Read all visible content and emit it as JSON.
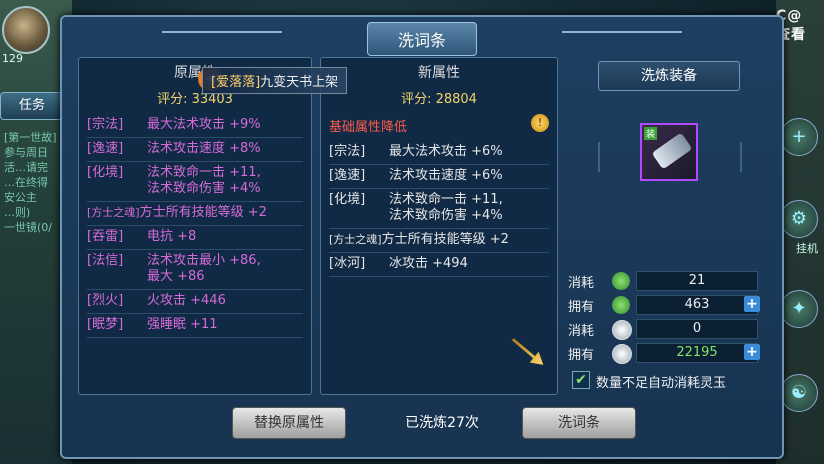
{
  "hud": {
    "level": "129",
    "task_tab": "任务",
    "task_lines": [
      "[第一世故]",
      "参与周日",
      "活…请完",
      "…在终得",
      "安公主",
      "…则)",
      "一世镜(0/"
    ],
    "top_logo": "C@ 查看",
    "side_labels": [
      "挂机"
    ]
  },
  "dialog": {
    "title": "洗词条",
    "notice": {
      "name": "[爱落落]",
      "text": "九变天书上架"
    },
    "left_panel": {
      "header": "原属性",
      "score_label": "评分: ",
      "score": "33403",
      "attributes": [
        {
          "tag": "[宗法]",
          "value": "最大法术攻击 +9%"
        },
        {
          "tag": "[逸速]",
          "value": "法术攻击速度 +8%"
        },
        {
          "tag": "[化境]",
          "value": "法术致命一击 +11,\n法术致命伤害 +4%"
        },
        {
          "tag": "[方士之魂]",
          "value": "方士所有技能等级 +2"
        },
        {
          "tag": "[吞雷]",
          "value": "电抗 +8"
        },
        {
          "tag": "[法信]",
          "value": "法术攻击最小 +86,\n最大 +86"
        },
        {
          "tag": "[烈火]",
          "value": "火攻击 +446"
        },
        {
          "tag": "[眠梦]",
          "value": "强睡眠 +11"
        }
      ]
    },
    "mid_panel": {
      "header": "新属性",
      "score_label": "评分: ",
      "score": "28804",
      "warning": "基础属性降低",
      "attributes": [
        {
          "tag": "[宗法]",
          "value": "最大法术攻击 +6%"
        },
        {
          "tag": "[逸速]",
          "value": "法术攻击速度 +6%"
        },
        {
          "tag": "[化境]",
          "value": "法术致命一击 +11,\n法术致命伤害 +4%"
        },
        {
          "tag": "[方士之魂]",
          "value": "方士所有技能等级 +2"
        },
        {
          "tag": "[冰河]",
          "value": "冰攻击 +494"
        }
      ]
    },
    "right_panel": {
      "header": "洗炼装备",
      "equip_badge": "装",
      "costs": [
        {
          "label": "消耗",
          "icon": "jade-icon",
          "value": "21",
          "plus": false
        },
        {
          "label": "拥有",
          "icon": "jade-icon",
          "value": "463",
          "plus": true
        },
        {
          "label": "消耗",
          "icon": "coin-icon",
          "value": "0",
          "plus": false
        },
        {
          "label": "拥有",
          "icon": "coin-icon",
          "value": "22195",
          "plus": true
        }
      ],
      "auto_label": "数量不足自动消耗灵玉"
    },
    "buttons": {
      "replace": "替换原属性",
      "wash": "洗词条"
    },
    "wash_count": "已洗炼27次"
  },
  "colors": {
    "accent": "#6f96b4",
    "purple": "#d56bd8",
    "gold": "#f3d36a",
    "warn": "#ff5a4a"
  }
}
